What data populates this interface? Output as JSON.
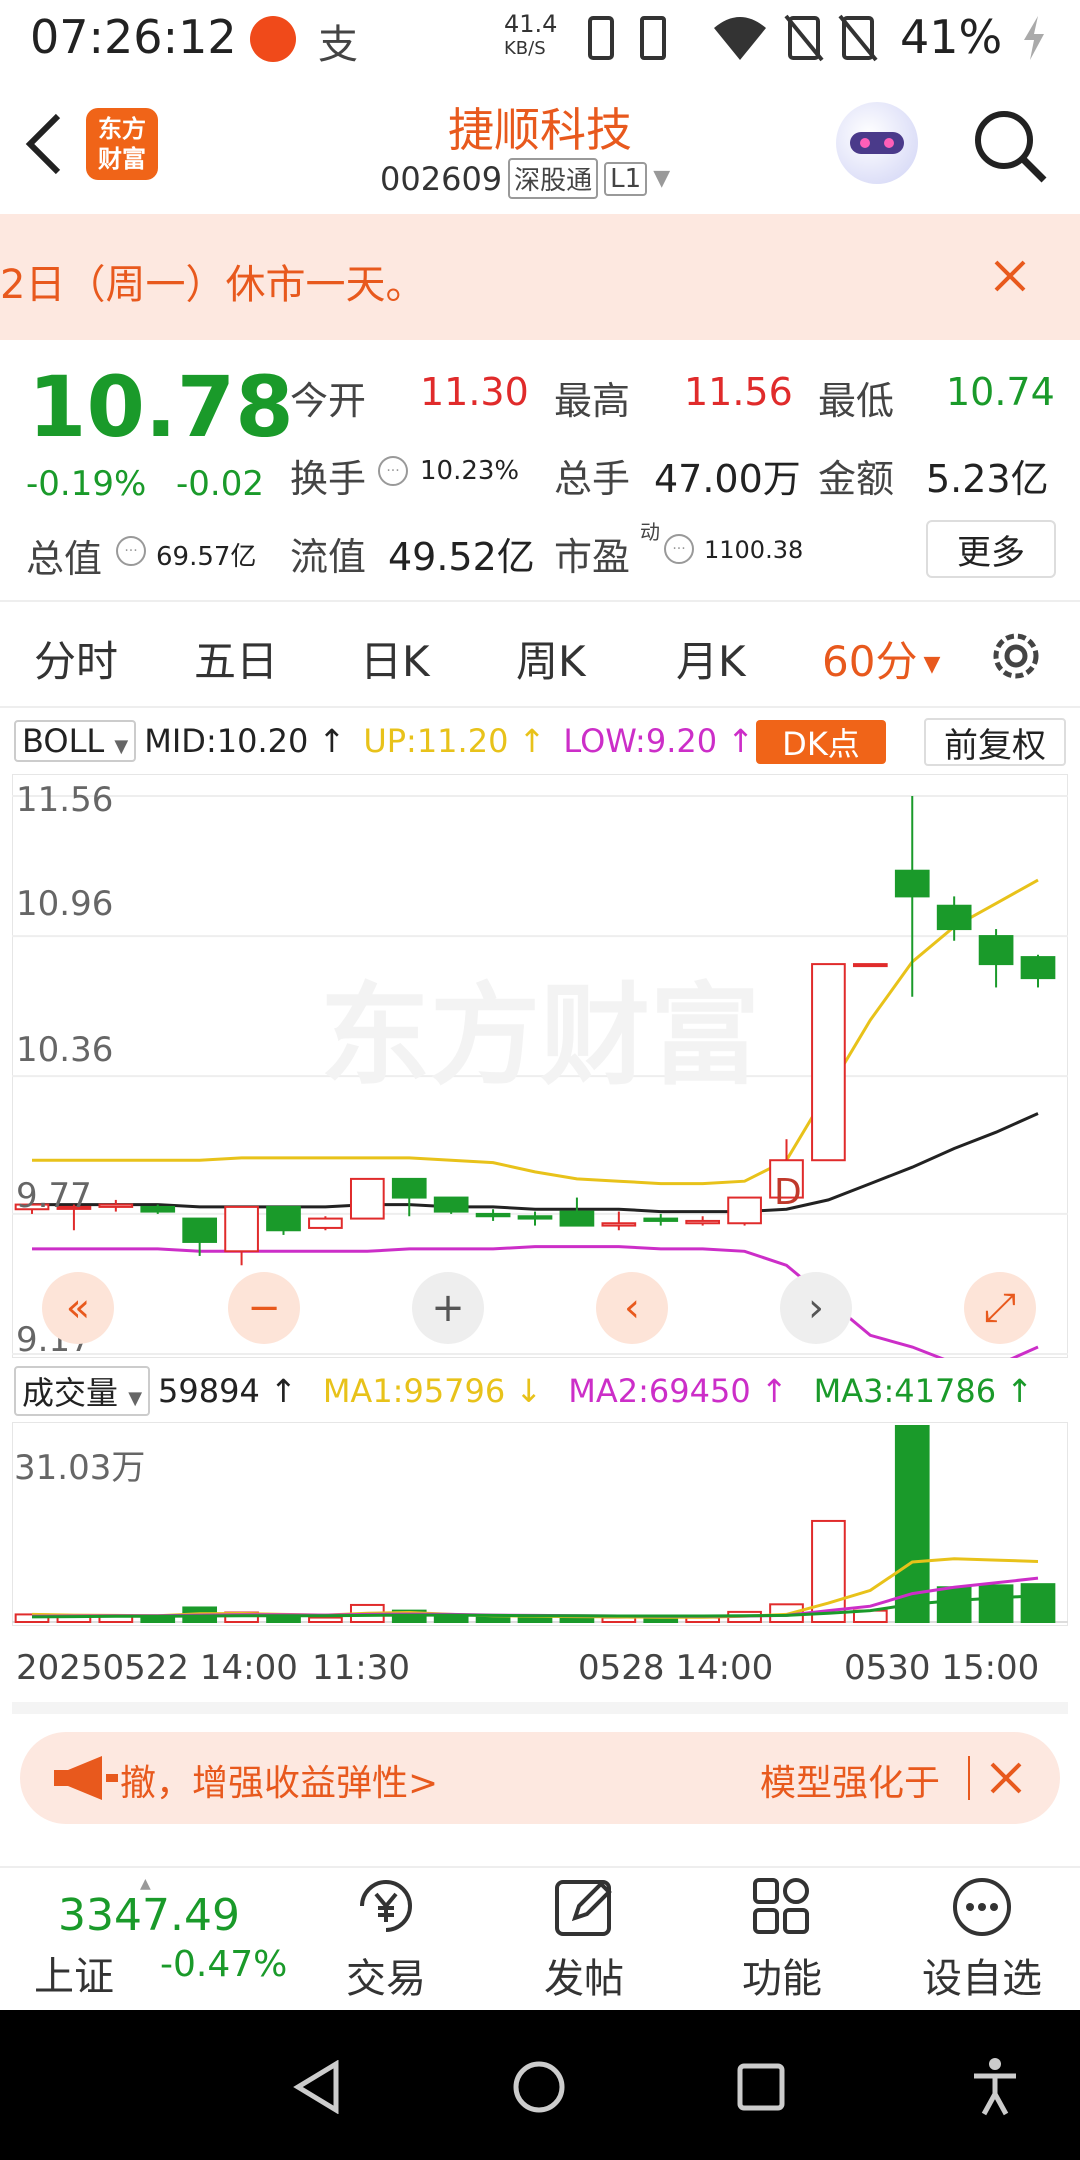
{
  "status_bar": {
    "time": "07:26:12",
    "net_speed_value": "41.4",
    "net_speed_unit": "KB/S",
    "battery": "41%"
  },
  "header": {
    "back_icon": "chevron-left-icon",
    "logo_text": "东方\n财富",
    "title": "捷顺科技",
    "code": "002609",
    "tag1": "深股通",
    "tag2": "L1"
  },
  "banner": {
    "text": "2日（周一）休市一天。"
  },
  "quote": {
    "price": "10.78",
    "change_pct": "-0.19%",
    "change": "-0.02",
    "open_label": "今开",
    "open": "11.30",
    "high_label": "最高",
    "high": "11.56",
    "low_label": "最低",
    "low": "10.74",
    "turnover_label": "换手",
    "turnover": "10.23%",
    "volume_label": "总手",
    "volume": "47.00万",
    "amount_label": "金额",
    "amount": "5.23亿",
    "mktcap_label": "总值",
    "mktcap": "69.57亿",
    "float_label": "流值",
    "float": "49.52亿",
    "pe_label": "市盈",
    "pe_sup": "动",
    "pe": "1100.38",
    "more": "更多"
  },
  "tabs": [
    "分时",
    "五日",
    "日K",
    "周K",
    "月K",
    "60分"
  ],
  "boll": {
    "name": "BOLL",
    "mid": "MID:10.20",
    "up": "UP:11.20",
    "low": "LOW:9.20",
    "dk": "DK点",
    "fq": "前复权",
    "y_labels": [
      "11.56",
      "10.96",
      "10.36",
      "9.77",
      "9.17"
    ],
    "marker": "D"
  },
  "volume": {
    "name": "成交量",
    "value": "59894",
    "ma1": "MA1:95796",
    "ma2": "MA2:69450",
    "ma3": "MA3:41786",
    "y_label": "31.03万",
    "x_labels": [
      "20250522 14:00",
      "11:30",
      "0528 14:00",
      "0530 15:00"
    ]
  },
  "ticker": {
    "left": "撤，增强收益弹性>",
    "right": "模型强化于"
  },
  "bottom_nav": {
    "index_value": "3347.49",
    "index_name": "上证",
    "index_change": "-0.47%",
    "items": [
      "交易",
      "发帖",
      "功能",
      "设自选"
    ]
  },
  "colors": {
    "accent": "#e8591d",
    "up": "#e02b2b",
    "down": "#1a9a2a",
    "mid_line": "#222222",
    "up_line": "#e8c21a",
    "low_line": "#cc2ec8"
  },
  "chart_data": {
    "type": "candlestick",
    "interval": "60分",
    "candles": [
      {
        "o": 9.79,
        "c": 9.81,
        "h": 9.83,
        "l": 9.77
      },
      {
        "o": 9.8,
        "c": 9.8,
        "h": 9.81,
        "l": 9.7
      },
      {
        "o": 9.8,
        "c": 9.81,
        "h": 9.83,
        "l": 9.78
      },
      {
        "o": 9.8,
        "c": 9.78,
        "h": 9.81,
        "l": 9.77
      },
      {
        "o": 9.75,
        "c": 9.65,
        "h": 9.75,
        "l": 9.59
      },
      {
        "o": 9.61,
        "c": 9.8,
        "h": 9.8,
        "l": 9.55
      },
      {
        "o": 9.8,
        "c": 9.7,
        "h": 9.8,
        "l": 9.68
      },
      {
        "o": 9.71,
        "c": 9.75,
        "h": 9.76,
        "l": 9.7
      },
      {
        "o": 9.75,
        "c": 9.92,
        "h": 9.92,
        "l": 9.75
      },
      {
        "o": 9.92,
        "c": 9.84,
        "h": 9.92,
        "l": 9.76
      },
      {
        "o": 9.84,
        "c": 9.78,
        "h": 9.84,
        "l": 9.77
      },
      {
        "o": 9.77,
        "c": 9.76,
        "h": 9.79,
        "l": 9.74
      },
      {
        "o": 9.76,
        "c": 9.75,
        "h": 9.78,
        "l": 9.72
      },
      {
        "o": 9.78,
        "c": 9.72,
        "h": 9.84,
        "l": 9.72
      },
      {
        "o": 9.72,
        "c": 9.73,
        "h": 9.78,
        "l": 9.7
      },
      {
        "o": 9.75,
        "c": 9.74,
        "h": 9.77,
        "l": 9.72
      },
      {
        "o": 9.73,
        "c": 9.74,
        "h": 9.76,
        "l": 9.72
      },
      {
        "o": 9.73,
        "c": 9.84,
        "h": 9.84,
        "l": 9.72
      },
      {
        "o": 9.84,
        "c": 10.0,
        "h": 10.09,
        "l": 9.84
      },
      {
        "o": 10.0,
        "c": 10.84,
        "h": 10.84,
        "l": 10.0
      },
      {
        "o": 10.84,
        "c": 10.84,
        "h": 10.84,
        "l": 10.84
      },
      {
        "o": 11.24,
        "c": 11.13,
        "h": 11.56,
        "l": 10.7
      },
      {
        "o": 11.09,
        "c": 10.99,
        "h": 11.13,
        "l": 10.94
      },
      {
        "o": 10.96,
        "c": 10.84,
        "h": 10.99,
        "l": 10.74
      },
      {
        "o": 10.87,
        "c": 10.78,
        "h": 10.88,
        "l": 10.74
      }
    ],
    "mid_line": [
      9.81,
      9.81,
      9.81,
      9.81,
      9.8,
      9.8,
      9.8,
      9.8,
      9.81,
      9.81,
      9.8,
      9.8,
      9.79,
      9.79,
      9.79,
      9.78,
      9.78,
      9.78,
      9.79,
      9.83,
      9.9,
      9.97,
      10.05,
      10.12,
      10.2
    ],
    "up_line": [
      10.0,
      10.0,
      10.0,
      10.0,
      10.0,
      10.01,
      10.01,
      10.01,
      10.01,
      10.01,
      10.0,
      9.99,
      9.95,
      9.92,
      9.91,
      9.9,
      9.9,
      9.91,
      10.0,
      10.3,
      10.6,
      10.85,
      11.0,
      11.1,
      11.2
    ],
    "low_line": [
      9.62,
      9.62,
      9.62,
      9.62,
      9.61,
      9.61,
      9.61,
      9.61,
      9.61,
      9.62,
      9.62,
      9.62,
      9.63,
      9.63,
      9.63,
      9.62,
      9.62,
      9.61,
      9.55,
      9.4,
      9.25,
      9.2,
      9.13,
      9.12,
      9.2
    ],
    "volumes": [
      12000,
      9000,
      11000,
      8000,
      23000,
      15000,
      8000,
      7000,
      27000,
      18000,
      9000,
      7000,
      6000,
      8000,
      7000,
      6000,
      7000,
      16000,
      28000,
      160000,
      18000,
      310300,
      55000,
      58000,
      59894
    ],
    "ma1": [
      12000,
      11000,
      10500,
      10000,
      13000,
      13500,
      12000,
      11000,
      14000,
      15000,
      12000,
      10000,
      9000,
      8500,
      8000,
      7500,
      7500,
      9000,
      12000,
      30000,
      50000,
      95000,
      100000,
      98000,
      95796
    ],
    "ma2": [
      9000,
      9500,
      10000,
      10000,
      11000,
      11500,
      11500,
      11000,
      12000,
      12500,
      12000,
      11000,
      10500,
      10000,
      9500,
      9000,
      9000,
      9500,
      10500,
      18000,
      25000,
      45000,
      55000,
      62000,
      69450
    ],
    "ma3": [
      8000,
      8500,
      9000,
      9000,
      9500,
      10000,
      10000,
      10000,
      10500,
      11000,
      11000,
      10500,
      10000,
      10000,
      9500,
      9500,
      9500,
      10000,
      10500,
      14000,
      18000,
      28000,
      34000,
      38000,
      41786
    ],
    "ylim": [
      9.17,
      11.56
    ],
    "vol_max": 310300
  }
}
